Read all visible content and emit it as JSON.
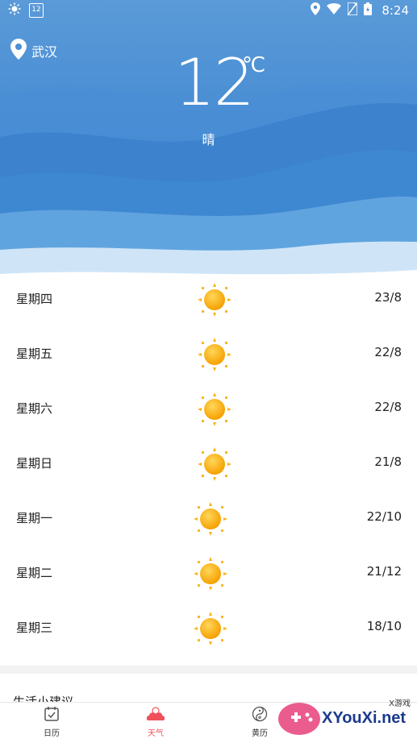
{
  "status_bar": {
    "time": "8:24",
    "calendar_day": "12",
    "icons": [
      "brightness-icon",
      "calendar-icon",
      "location-icon",
      "wifi-icon",
      "no-sim-icon",
      "battery-icon"
    ]
  },
  "location": {
    "city": "武汉"
  },
  "current": {
    "temperature": "12",
    "unit": "℃",
    "condition": "晴"
  },
  "forecast": [
    {
      "day": "星期四",
      "range": "23/8",
      "icon": "sun-icon"
    },
    {
      "day": "星期五",
      "range": "22/8",
      "icon": "sun-icon"
    },
    {
      "day": "星期六",
      "range": "22/8",
      "icon": "sun-icon"
    },
    {
      "day": "星期日",
      "range": "21/8",
      "icon": "sun-icon"
    },
    {
      "day": "星期一",
      "range": "22/10",
      "icon": "sun-icon"
    },
    {
      "day": "星期二",
      "range": "21/12",
      "icon": "sun-icon"
    },
    {
      "day": "星期三",
      "range": "18/10",
      "icon": "sun-icon"
    }
  ],
  "life_section": {
    "title": "生活小建议"
  },
  "tabs": [
    {
      "label": "日历",
      "icon": "calendar-icon",
      "active": false
    },
    {
      "label": "天气",
      "icon": "weather-icon",
      "active": true
    },
    {
      "label": "黄历",
      "icon": "yin-yang-icon",
      "active": false
    }
  ],
  "watermark": {
    "brand": "XYouXi.net",
    "tag": "X游戏"
  },
  "colors": {
    "sky_top": "#5a9ad8",
    "sky_mid": "#3d86cf",
    "active_tab": "#f0505a",
    "sun": "#f7b21c"
  }
}
